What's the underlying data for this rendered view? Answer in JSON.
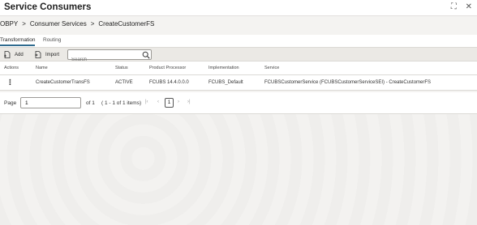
{
  "window": {
    "title": "Service Consumers",
    "controls": [
      "⛶",
      "✕"
    ]
  },
  "breadcrumb": {
    "items": [
      "OBPY",
      "Consumer Services",
      "CreateCustomerFS"
    ],
    "separator": ">"
  },
  "tabs": [
    {
      "label": "Transformation",
      "active": true
    },
    {
      "label": "Routing",
      "active": false
    }
  ],
  "toolbar": {
    "add_label": "Add",
    "import_label": "Import",
    "search_placeholder": "Search"
  },
  "table": {
    "headers": {
      "actions": "Actions",
      "name": "Name",
      "status": "Status",
      "processor": "Product Processor",
      "implementation": "Implementation",
      "service": "Service"
    },
    "rows": [
      {
        "actions": "⋮",
        "name": "CreateCustomerTransFS",
        "status": "ACTIVE",
        "processor": "FCUBS 14.4.0.0.0",
        "implementation": "FCUBS_Default",
        "service": "FCUBSCustomerService (FCUBSCustomerServiceSEI) - CreateCustomerFS"
      }
    ]
  },
  "pager": {
    "page_label": "Page",
    "page_value": "1",
    "of_label": "of 1",
    "items_label": "( 1 - 1 of 1 items)",
    "current_page": "1",
    "first": "|‹",
    "prev": "‹",
    "next": "›",
    "last": "›|"
  },
  "colors": {
    "accent": "#2f6b8f",
    "toolbar_bg": "#ebe9e5",
    "page_bg": "#f4f3f1"
  }
}
